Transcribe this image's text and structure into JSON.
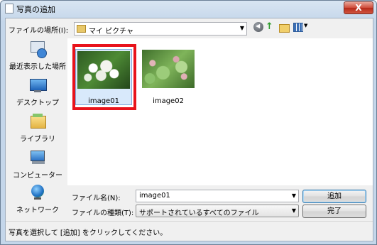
{
  "window": {
    "title": "写真の追加",
    "close_label": "X"
  },
  "location": {
    "label": "ファイルの場所(I):",
    "value": "マイ ピクチャ"
  },
  "places": [
    {
      "label": "最近表示した場所",
      "icon": "recent-places-icon"
    },
    {
      "label": "デスクトップ",
      "icon": "desktop-icon"
    },
    {
      "label": "ライブラリ",
      "icon": "library-icon"
    },
    {
      "label": "コンピューター",
      "icon": "computer-icon"
    },
    {
      "label": "ネットワーク",
      "icon": "network-icon"
    }
  ],
  "files": [
    {
      "name": "image01",
      "selected": true
    },
    {
      "name": "image02",
      "selected": false
    }
  ],
  "filename": {
    "label": "ファイル名(N):",
    "value": "image01"
  },
  "filetype": {
    "label": "ファイルの種類(T):",
    "value": "サポートされているすべてのファイル"
  },
  "buttons": {
    "add": "追加",
    "done": "完了"
  },
  "status": "写真を選択して [追加] をクリックしてください。",
  "colors": {
    "highlight": "#e8131b",
    "selection": "#d8e9fb"
  }
}
